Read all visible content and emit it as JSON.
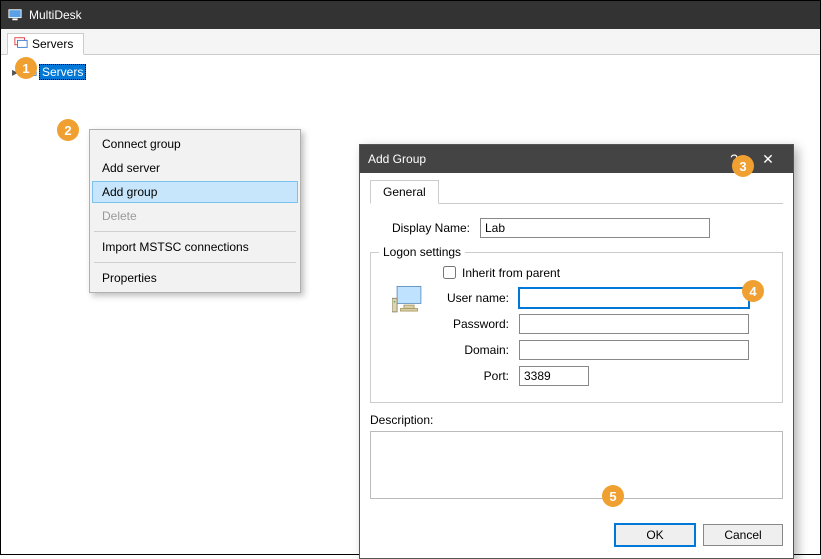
{
  "app": {
    "title": "MultiDesk"
  },
  "mainTab": {
    "label": "Servers"
  },
  "tree": {
    "root": "Servers"
  },
  "contextMenu": {
    "items": [
      {
        "label": "Connect group"
      },
      {
        "label": "Add server"
      },
      {
        "label": "Add group"
      },
      {
        "label": "Delete"
      },
      {
        "label": "Import MSTSC connections"
      },
      {
        "label": "Properties"
      }
    ]
  },
  "dialog": {
    "title": "Add Group",
    "help": "?",
    "close": "✕",
    "tabs": {
      "general": "General"
    },
    "displayName": {
      "label": "Display Name:",
      "value": "Lab"
    },
    "logon": {
      "legend": "Logon settings",
      "inherit": "Inherit from parent",
      "username": {
        "label": "User name:",
        "value": ""
      },
      "password": {
        "label": "Password:",
        "value": ""
      },
      "domain": {
        "label": "Domain:",
        "value": ""
      },
      "port": {
        "label": "Port:",
        "value": "3389"
      }
    },
    "description": {
      "label": "Description:",
      "value": ""
    },
    "buttons": {
      "ok": "OK",
      "cancel": "Cancel"
    }
  },
  "badges": {
    "b1": "1",
    "b2": "2",
    "b3": "3",
    "b4": "4",
    "b5": "5"
  }
}
